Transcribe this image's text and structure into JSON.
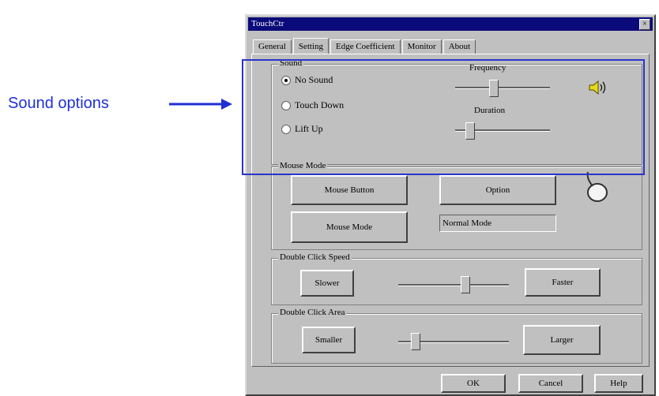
{
  "annotation": {
    "label": "Sound options"
  },
  "window": {
    "title": "TouchCtr",
    "close_glyph": "×",
    "tabs": [
      "General",
      "Setting",
      "Edge Coefficient",
      "Monitor",
      "About"
    ],
    "active_tab": "Setting"
  },
  "sound": {
    "group_title": "Sound",
    "options": [
      "No Sound",
      "Touch Down",
      "Lift Up"
    ],
    "selected_option": "No Sound",
    "frequency_label": "Frequency",
    "frequency_level": 0.4,
    "duration_label": "Duration",
    "duration_level": 0.15,
    "icon": "speaker-icon"
  },
  "mouse_mode": {
    "group_title": "Mouse Mode",
    "button_label": "Mouse Button",
    "option_label": "Option",
    "mode_button_label": "Mouse Mode",
    "mode_value": "Normal Mode",
    "icon": "mouse-icon"
  },
  "double_click_speed": {
    "group_title": "Double Click Speed",
    "slow_label": "Slower",
    "fast_label": "Faster",
    "level": 0.6
  },
  "double_click_area": {
    "group_title": "Double Click Area",
    "smaller_label": "Smaller",
    "larger_label": "Larger",
    "level": 0.15
  },
  "footer": {
    "ok_label": "OK",
    "cancel_label": "Cancel",
    "help_label": "Help"
  },
  "colors": {
    "annotation_blue": "#1f2fd6",
    "title_bar": "#0a0a7a",
    "dialog_gray": "#c0c0c0"
  }
}
